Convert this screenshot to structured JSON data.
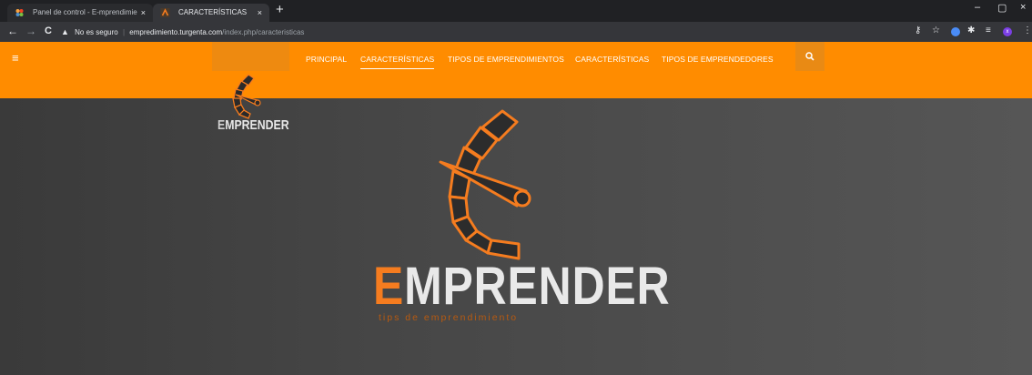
{
  "browser": {
    "tabs": [
      {
        "title": "Panel de control - E-mprendimie",
        "close": "×"
      },
      {
        "title": "CARACTERÍSTICAS",
        "close": "×"
      }
    ],
    "new_tab": "+",
    "window_controls": {
      "minimize": "–",
      "maximize": "▢",
      "close": "×"
    },
    "nav": {
      "back": "←",
      "forward": "→",
      "reload": "C"
    },
    "address": {
      "security_label": "No es seguro",
      "host": "empredimiento.turgenta.com",
      "path": "/index.php/caracteristicas"
    },
    "toolbar_icons": [
      "key-icon",
      "star-icon",
      "extension-icon",
      "puzzle-icon",
      "playlist-icon",
      "profile-icon",
      "menu-icon"
    ],
    "profile_initial": "x"
  },
  "site": {
    "colors": {
      "brand": "#ff8c00",
      "logo_orange": "#f57c1f",
      "hero_bg": "#474747"
    },
    "menu": {
      "hamburger": "≡",
      "items": [
        {
          "label": "PRINCIPAL"
        },
        {
          "label": "CARACTERÍSTICAS",
          "active": true
        },
        {
          "label": "TIPOS DE EMPRENDIMIENTOS"
        },
        {
          "label": "CARACTERÍSTICAS"
        },
        {
          "label": "TIPOS DE EMPRENDEDORES"
        }
      ],
      "search_icon": "search-icon"
    },
    "small_logo": {
      "first_letter": "E",
      "rest": "MPRENDER"
    },
    "big_logo": {
      "first_letter": "E",
      "rest": "MPRENDER",
      "tagline": "tips de emprendimiento"
    }
  }
}
